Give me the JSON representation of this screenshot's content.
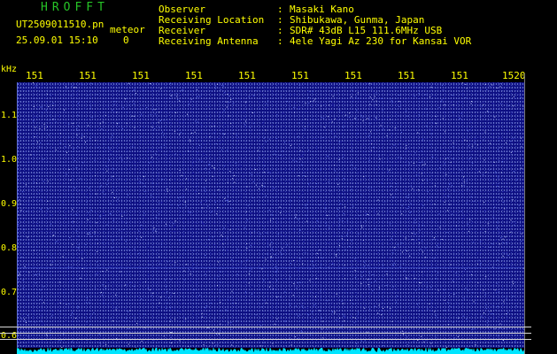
{
  "header": {
    "app_title": "HROFFT",
    "filename": "UT2509011510.pn",
    "meteor_label": "meteor",
    "datetime": "25.09.01 15:10",
    "count": "0"
  },
  "info": [
    {
      "label": "Observer",
      "colon": ":",
      "value": "Masaki Kano"
    },
    {
      "label": "Receiving Location",
      "colon": ":",
      "value": "Shibukawa, Gunma, Japan"
    },
    {
      "label": "Receiver",
      "colon": ":",
      "value": "SDR# 43dB L15 111.6MHz USB"
    },
    {
      "label": "Receiving Antenna",
      "colon": ":",
      "value": "4ele Yagi Az 230 for Kansai VOR"
    }
  ],
  "axes": {
    "y_unit": "kHz",
    "y_ticks": [
      "1.1",
      "1.0",
      "0.9",
      "0.8",
      "0.7",
      "0.6"
    ],
    "x_ticks": [
      "151",
      "151",
      "151",
      "151",
      "151",
      "151",
      "151",
      "151",
      "151",
      "1520"
    ]
  },
  "colors": {
    "title": "#27c427",
    "info": "#ffff00",
    "axis_labels": "#ffff00",
    "waterfall_bg": "#0d0f82",
    "spectrum": "#00e5ff",
    "marker_line": "#d8d8d8"
  }
}
